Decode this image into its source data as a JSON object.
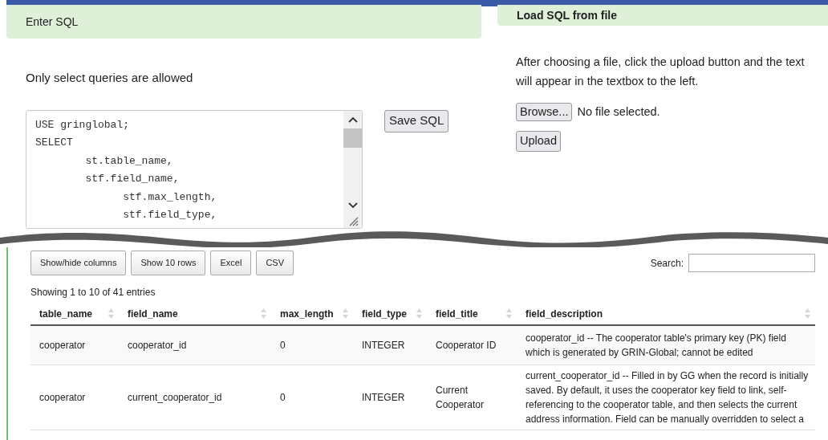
{
  "enter_sql": {
    "title": "Enter SQL",
    "note": "Only select queries are allowed",
    "sql_lines": [
      "USE gringlobal;",
      "SELECT",
      "        st.table_name,",
      "        stf.field_name,",
      "              stf.max_length,",
      "              stf.field_type,"
    ],
    "save_button": "Save SQL"
  },
  "load_sql": {
    "title": "Load SQL from file",
    "instructions": "After choosing a file, click the upload button and the text will appear in the textbox to the left.",
    "browse_button": "Browse...",
    "file_status": "No file selected.",
    "upload_button": "Upload"
  },
  "results": {
    "buttons": [
      "Show/hide columns",
      "Show 10 rows",
      "Excel",
      "CSV"
    ],
    "search_label": "Search:",
    "info": "Showing 1 to 10 of 41 entries",
    "columns": [
      "table_name",
      "field_name",
      "max_length",
      "field_type",
      "field_title",
      "field_description"
    ],
    "rows": [
      [
        "cooperator",
        "cooperator_id",
        "0",
        "INTEGER",
        "Cooperator ID",
        "cooperator_id -- The cooperator table's primary key (PK) field which is generated by GRIN-Global; cannot be edited"
      ],
      [
        "cooperator",
        "current_cooperator_id",
        "0",
        "INTEGER",
        "Current Cooperator",
        "current_cooperator_id -- Filled in by GG when the record is initially saved. By default, it uses the cooperator key field to link, self-referencing to the cooperator table, and then selects the current address information. Field can be manually overridden to select a"
      ]
    ]
  }
}
